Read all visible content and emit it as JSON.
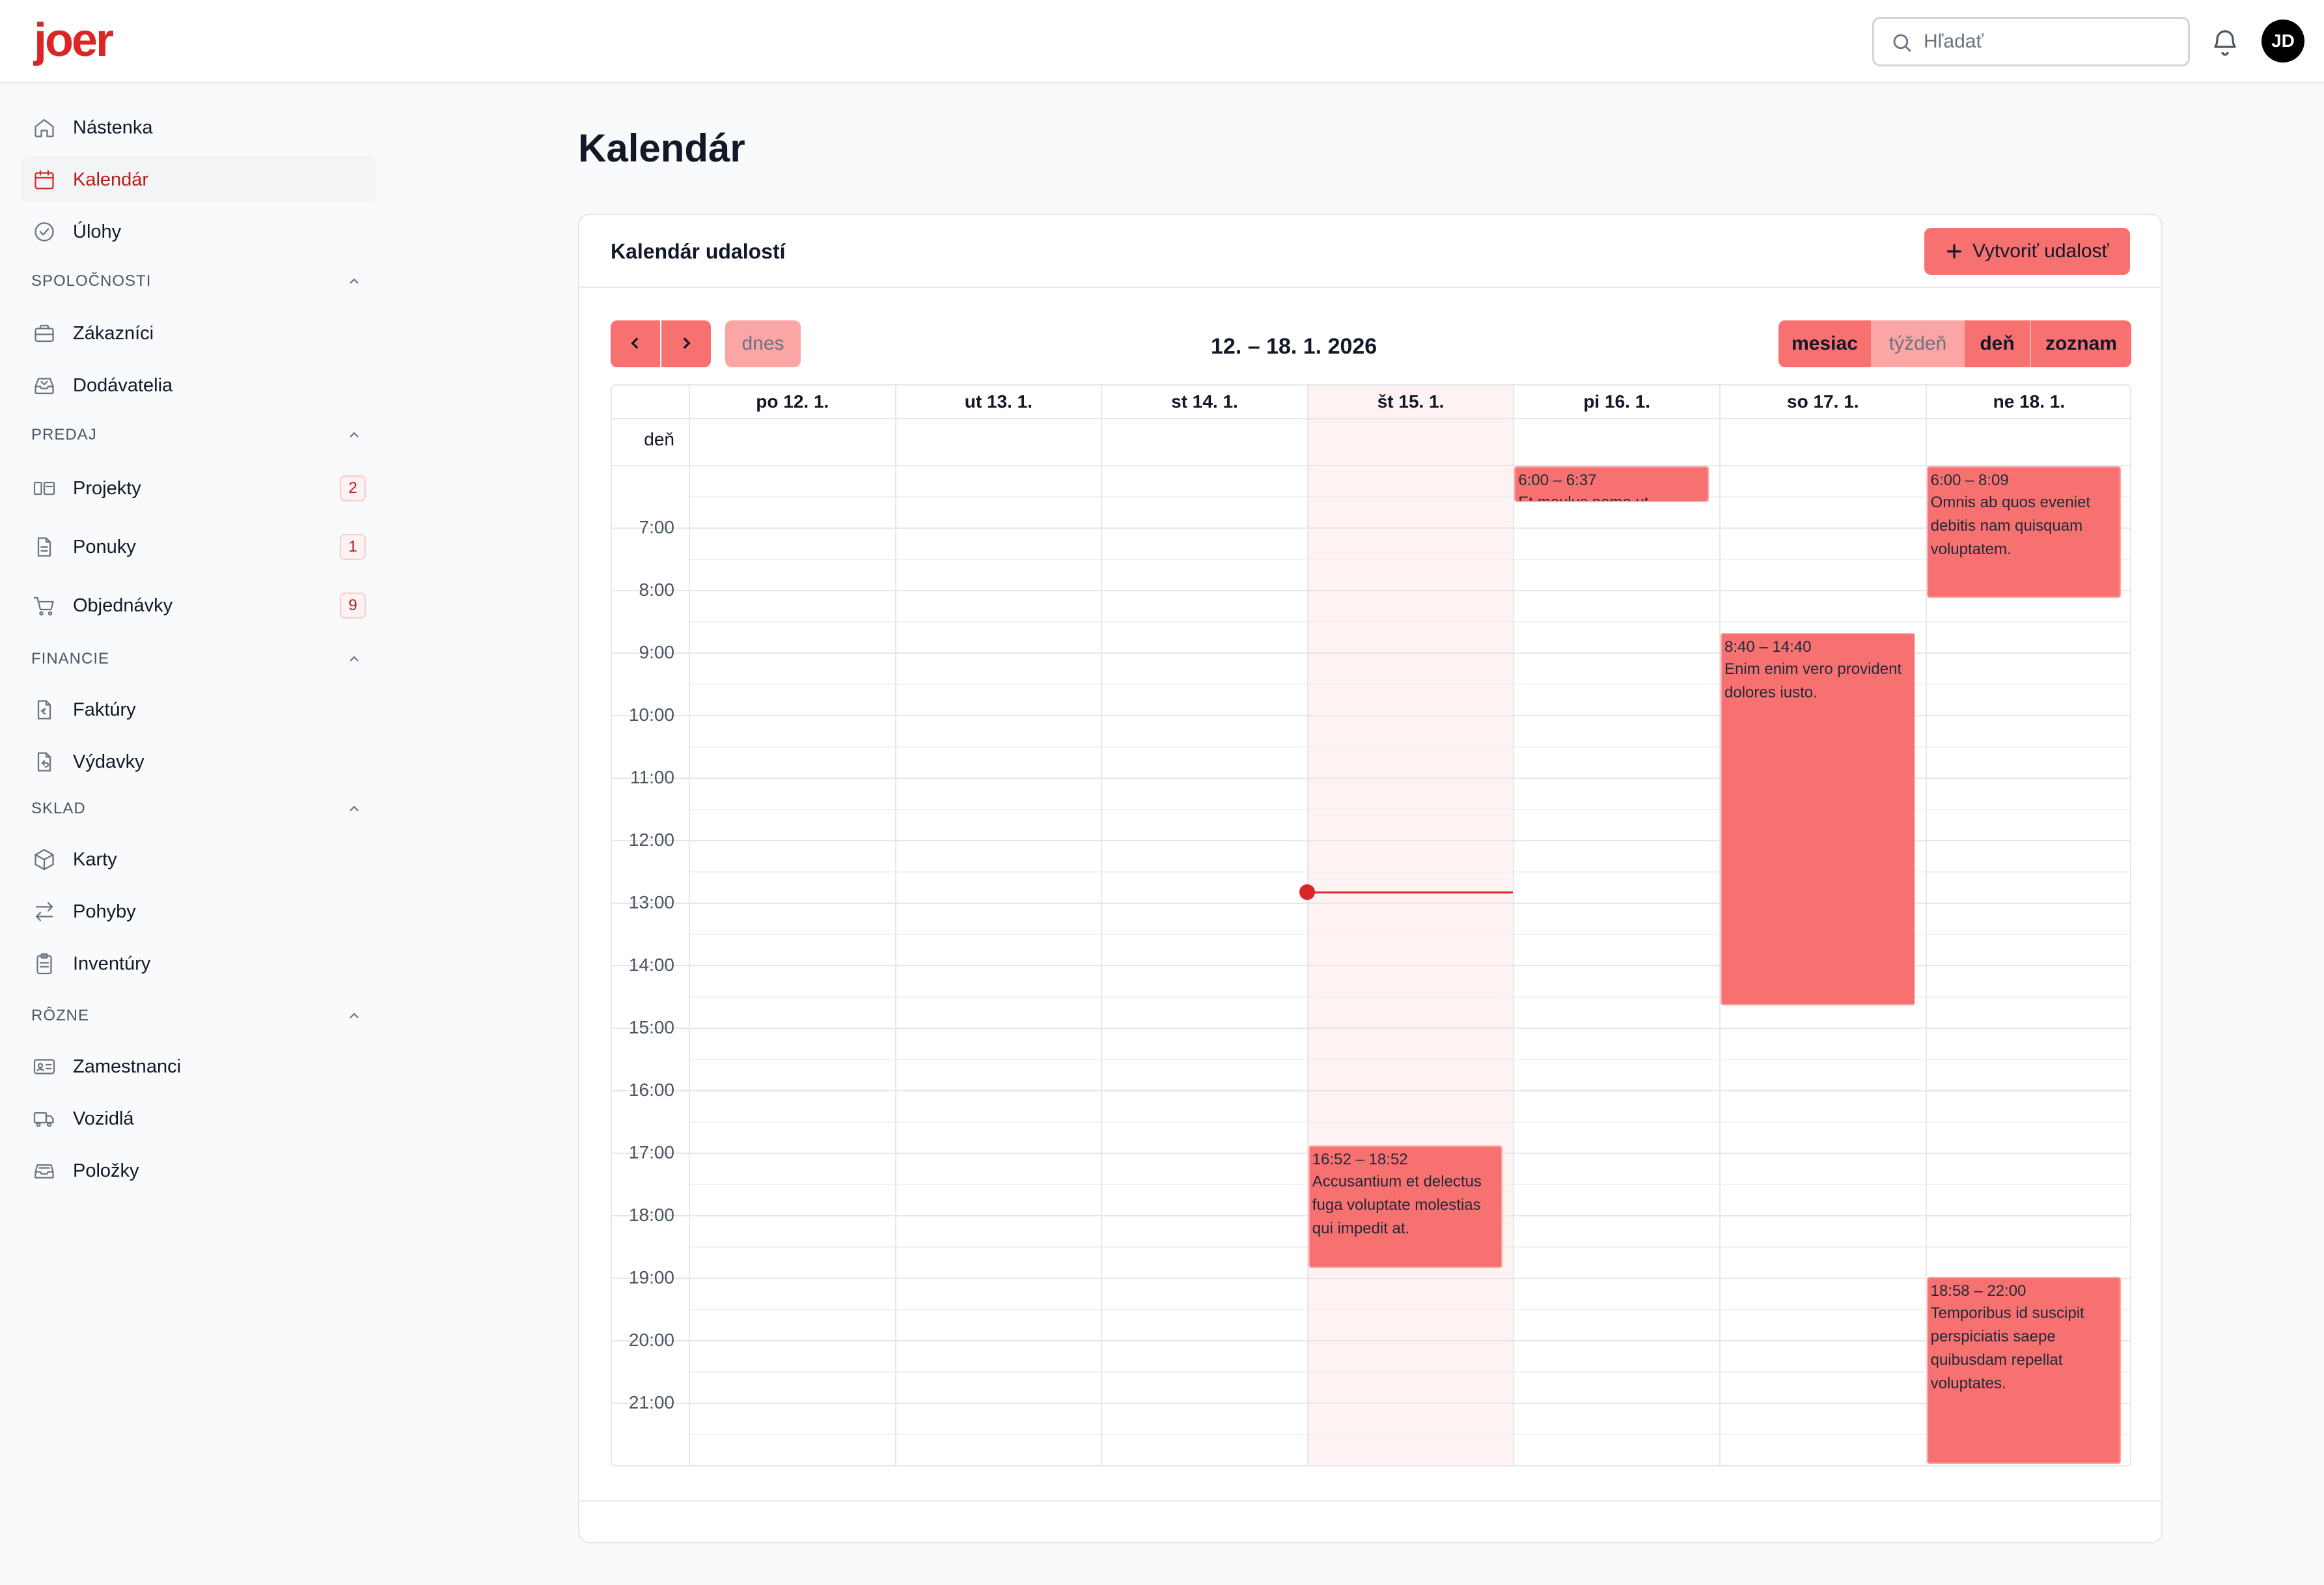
{
  "brand": {
    "logo_text": "joer",
    "accent": "#dc2626",
    "event_color": "#f87171"
  },
  "header": {
    "search_placeholder": "Hľadať",
    "avatar_initials": "JD"
  },
  "sidebar": {
    "top_items": [
      {
        "label": "Nástenka",
        "icon": "home-icon"
      },
      {
        "label": "Kalendár",
        "icon": "calendar-icon",
        "active": true
      },
      {
        "label": "Úlohy",
        "icon": "check-circle-icon"
      }
    ],
    "sections": [
      {
        "title": "SPOLOČNOSTI",
        "items": [
          {
            "label": "Zákazníci",
            "icon": "briefcase-icon"
          },
          {
            "label": "Dodávatelia",
            "icon": "inbox-icon"
          }
        ]
      },
      {
        "title": "PREDAJ",
        "items": [
          {
            "label": "Projekty",
            "icon": "projects-icon",
            "badge": "2"
          },
          {
            "label": "Ponuky",
            "icon": "document-icon",
            "badge": "1"
          },
          {
            "label": "Objednávky",
            "icon": "cart-icon",
            "badge": "9"
          }
        ]
      },
      {
        "title": "FINANCIE",
        "items": [
          {
            "label": "Faktúry",
            "icon": "invoice-icon"
          },
          {
            "label": "Výdavky",
            "icon": "expense-icon"
          }
        ]
      },
      {
        "title": "SKLAD",
        "items": [
          {
            "label": "Karty",
            "icon": "cube-icon"
          },
          {
            "label": "Pohyby",
            "icon": "arrows-icon"
          },
          {
            "label": "Inventúry",
            "icon": "clipboard-icon"
          }
        ]
      },
      {
        "title": "RÔZNE",
        "items": [
          {
            "label": "Zamestnanci",
            "icon": "id-card-icon"
          },
          {
            "label": "Vozidlá",
            "icon": "truck-icon"
          },
          {
            "label": "Položky",
            "icon": "tray-icon"
          }
        ]
      }
    ]
  },
  "main": {
    "page_title": "Kalendár",
    "card_title": "Kalendár udalostí",
    "create_button": "Vytvoriť udalosť",
    "today_button": "dnes",
    "range_title": "12. – 18. 1. 2026",
    "views": [
      "mesiac",
      "týždeň",
      "deň",
      "zoznam"
    ],
    "selected_view": "týždeň",
    "allday_label": "deň",
    "days": [
      "po 12. 1.",
      "ut 13. 1.",
      "st 14. 1.",
      "št 15. 1.",
      "pi 16. 1.",
      "so 17. 1.",
      "ne 18. 1."
    ],
    "today_day": "št 15. 1.",
    "now_time": "12:50",
    "hours": [
      "7:00",
      "8:00",
      "9:00",
      "10:00",
      "11:00",
      "12:00",
      "13:00",
      "14:00",
      "15:00",
      "16:00",
      "17:00",
      "18:00",
      "19:00",
      "20:00",
      "21:00"
    ],
    "events": [
      {
        "day": 4,
        "start": "6:00",
        "end": "6:37",
        "time": "6:00 – 6:37",
        "title": "Et moulus nemo ut"
      },
      {
        "day": 6,
        "start": "6:00",
        "end": "8:09",
        "time": "6:00 – 8:09",
        "title": "Omnis ab quos eveniet debitis nam quisquam voluptatem."
      },
      {
        "day": 5,
        "start": "8:40",
        "end": "14:40",
        "time": "8:40 – 14:40",
        "title": "Enim enim vero provident dolores iusto."
      },
      {
        "day": 3,
        "start": "16:52",
        "end": "18:52",
        "time": "16:52 – 18:52",
        "title": "Accusantium et delectus fuga voluptate molestias qui impedit at."
      },
      {
        "day": 6,
        "start": "18:58",
        "end": "22:00",
        "time": "18:58 – 22:00",
        "title": "Temporibus id suscipit perspiciatis saepe quibusdam repellat voluptates."
      }
    ]
  }
}
